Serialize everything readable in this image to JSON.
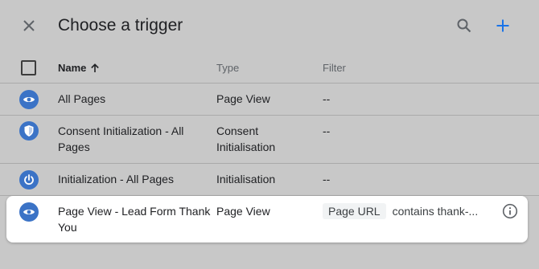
{
  "header": {
    "title": "Choose a trigger"
  },
  "columns": {
    "name": "Name",
    "type": "Type",
    "filter": "Filter"
  },
  "rows": [
    {
      "name": "All Pages",
      "type": "Page View",
      "filter": "--",
      "icon": "eye-icon"
    },
    {
      "name": "Consent Initialization - All Pages",
      "type": "Consent Initialisation",
      "filter": "--",
      "icon": "shield-icon"
    },
    {
      "name": "Initialization - All Pages",
      "type": "Initialisation",
      "filter": "--",
      "icon": "power-icon"
    },
    {
      "name": "Page View - Lead Form Thank You",
      "type": "Page View",
      "filter_chip": "Page URL",
      "filter_text": "contains thank-...",
      "icon": "eye-icon"
    }
  ],
  "colors": {
    "accent": "#1a73e8",
    "trigger_icon_bg": "#3b73c6",
    "overlay_bg": "#c8c8c8"
  }
}
